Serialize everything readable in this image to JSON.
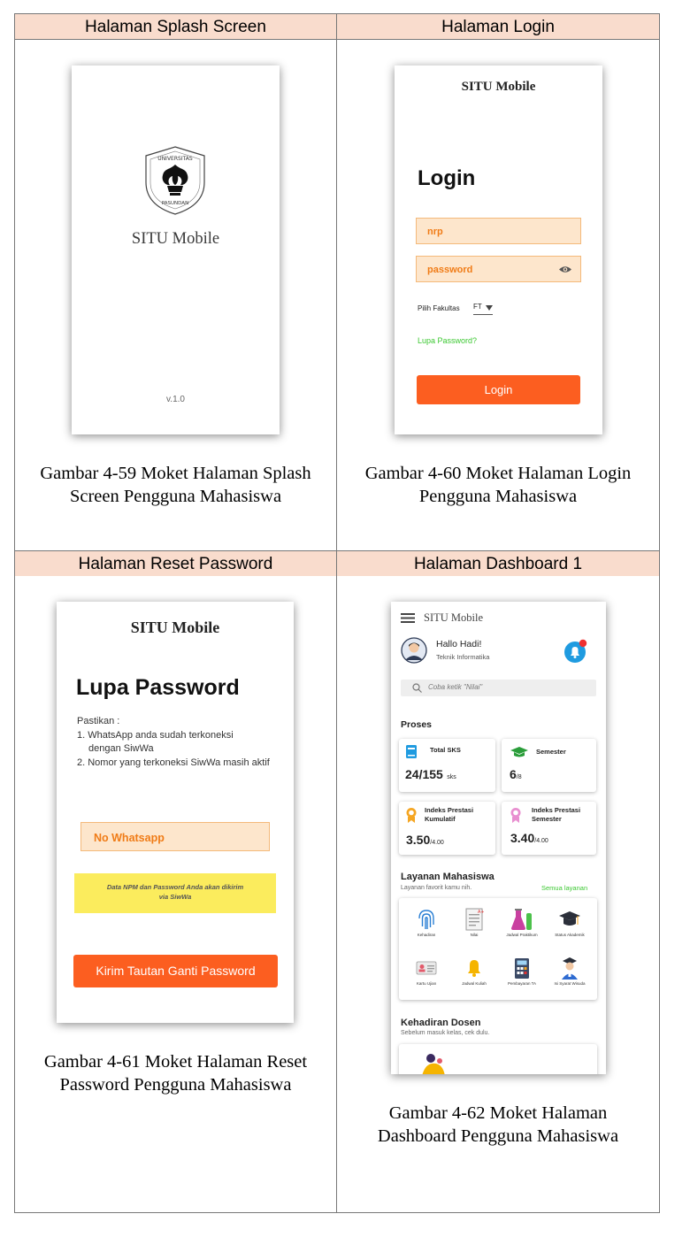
{
  "headers": {
    "splash": "Halaman Splash Screen",
    "login": "Halaman Login",
    "reset": "Halaman Reset Password",
    "dashboard": "Halaman Dashboard 1"
  },
  "captions": {
    "splash": [
      "Gambar 4-59 Moket Halaman Splash",
      "Screen Pengguna Mahasiswa"
    ],
    "login": [
      "Gambar 4-60 Moket Halaman Login",
      "Pengguna Mahasiswa"
    ],
    "reset": [
      "Gambar 4-61 Moket Halaman Reset",
      "Password Pengguna Mahasiswa"
    ],
    "dashboard": [
      "Gambar 4-62 Moket Halaman",
      "Dashboard Pengguna Mahasiswa"
    ]
  },
  "splash": {
    "logo_top": "UNIVERSITAS",
    "logo_bottom": "PASUNDAN",
    "app_name": "SITU Mobile",
    "version": "v.1.0"
  },
  "login": {
    "app_name": "SITU Mobile",
    "heading": "Login",
    "nrp_placeholder": "nrp",
    "password_placeholder": "password",
    "faculty_label": "Pilih Fakultas",
    "faculty_value": "FT",
    "forgot_link": "Lupa Password?",
    "login_button": "Login"
  },
  "reset": {
    "app_name": "SITU Mobile",
    "heading": "Lupa Password",
    "intro": "Pastikan :",
    "items": [
      "1. WhatsApp anda sudah terkoneksi",
      "dengan SiwWa",
      "2. Nomor yang terkoneksi SiwWa masih aktif"
    ],
    "whatsapp_placeholder": "No Whatsapp",
    "note": [
      "Data NPM dan Password Anda akan dikirim",
      "via SiwWa"
    ],
    "submit_button": "Kirim Tautan Ganti Password"
  },
  "dashboard": {
    "app_name": "SITU Mobile",
    "greeting": "Hallo Hadi!",
    "program": "Teknik Informatika",
    "search_placeholder": "Coba ketik \"Nilai\"",
    "process_title": "Proses",
    "cards": [
      {
        "label": "Total SKS",
        "value": "24/155",
        "unit": "sks"
      },
      {
        "label": "Semester",
        "value": "6",
        "unit": "/8"
      },
      {
        "label": "Indeks Prestasi Kumulatif",
        "value": "3.50",
        "unit": "/4.00"
      },
      {
        "label": "Indeks Prestasi Semester",
        "value": "3.40",
        "unit": "/4.00"
      }
    ],
    "services_title": "Layanan Mahasiswa",
    "services_subtitle": "Layanan favorit kamu nih.",
    "services_link": "Semua layanan",
    "services": [
      "Kehadiran",
      "Nilai",
      "Jadwal Praktikum",
      "Status Akademik",
      "Kartu Ujian",
      "Jadwal Kuliah",
      "Pembayaran TA",
      "Isi Syarat Wisuda"
    ],
    "lecturer_title": "Kehadiran Dosen",
    "lecturer_subtitle": "Sebelum masuk kelas, cek dulu."
  },
  "colors": {
    "header_bg": "#f9dccd",
    "accent_orange": "#fc5e20",
    "field_bg": "#fde6cc",
    "link_green": "#3cc832",
    "note_yellow": "#fbec5d"
  }
}
